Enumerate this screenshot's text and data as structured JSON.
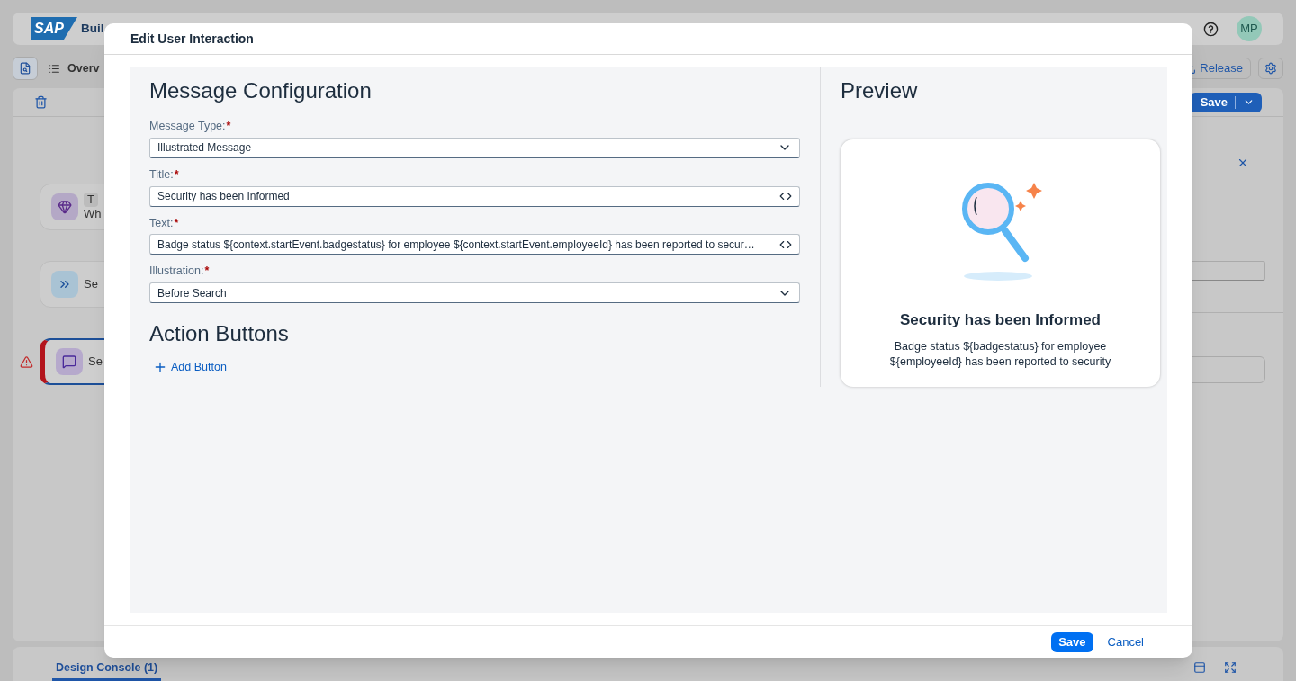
{
  "app_header": {
    "logo": "SAP",
    "title": "Buil",
    "avatar": "MP"
  },
  "toolbar": {
    "breadcrumb": "Overv",
    "release_button": "Release"
  },
  "editor_toolbar": {
    "save_button": "Save"
  },
  "canvas_nodes": [
    {
      "kind": "trigger",
      "tag": "T",
      "label": "Wh",
      "selected": false,
      "error": false
    },
    {
      "kind": "automation",
      "label": "Se",
      "selected": false,
      "error": false
    },
    {
      "kind": "form",
      "label": "Se",
      "selected": true,
      "error": true
    }
  ],
  "bottom_panel": {
    "tabs": [
      {
        "label": "Design Console (1)",
        "selected": true
      }
    ]
  },
  "dialog": {
    "title": "Edit User Interaction",
    "configuration": {
      "heading": "Message Configuration",
      "fields": [
        {
          "label": "Message Type:",
          "required_mark": "*",
          "kind": "select",
          "value": "Illustrated Message"
        },
        {
          "label": "Title:",
          "required_mark": "*",
          "kind": "expression",
          "value": "Security has been Informed"
        },
        {
          "label": "Text:",
          "required_mark": "*",
          "kind": "expression",
          "value": "Badge status ${context.startEvent.badgestatus} for employee ${context.startEvent.employeeId} has been reported to secur…"
        },
        {
          "label": "Illustration:",
          "required_mark": "*",
          "kind": "select",
          "value": "Before Search"
        }
      ]
    },
    "action_buttons": {
      "heading": "Action Buttons",
      "add_button": "Add Button"
    },
    "preview": {
      "heading": "Preview",
      "title": "Security has been Informed",
      "description": "Badge status ${badgestatus} for employee ${employeeId} has been reported to security"
    },
    "footer": {
      "save_button": "Save",
      "cancel_button": "Cancel"
    }
  }
}
